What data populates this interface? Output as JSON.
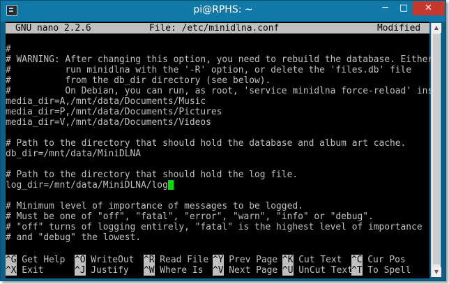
{
  "window": {
    "title": "pi@RPHS: ~",
    "minimize": "─",
    "maximize": "□",
    "close": "✕"
  },
  "nano": {
    "version": "GNU nano 2.2.6",
    "file": "File: /etc/minidlna.conf",
    "status": "Modified"
  },
  "content_lines": [
    "",
    "#",
    "# WARNING: After changing this option, you need to rebuild the database. Either",
    "#          run minidlna with the '-R' option, or delete the 'files.db' file",
    "#          from the db_dir directory (see below).",
    "#          On Debian, you can run, as root, 'service minidlna force-reload' ins$",
    "media_dir=A,/mnt/data/Documents/Music",
    "media_dir=P,/mnt/data/Documents/Pictures",
    "media_dir=V,/mnt/data/Documents/Videos",
    "",
    "# Path to the directory that should hold the database and album art cache.",
    "db_dir=/mnt/data/MiniDLNA",
    "",
    "# Path to the directory that should hold the log file.",
    "log_dir=/mnt/data/MiniDLNA/log",
    "",
    "# Minimum level of importance of messages to be logged.",
    "# Must be one of \"off\", \"fatal\", \"error\", \"warn\", \"info\" or \"debug\".",
    "# \"off\" turns of logging entirely, \"fatal\" is the highest level of importance",
    "# and \"debug\" the lowest."
  ],
  "shortcuts": [
    {
      "key": "^G",
      "label": " Get Help"
    },
    {
      "key": "^O",
      "label": " WriteOut"
    },
    {
      "key": "^R",
      "label": " Read File"
    },
    {
      "key": "^Y",
      "label": " Prev Page"
    },
    {
      "key": "^K",
      "label": " Cut Text"
    },
    {
      "key": "^C",
      "label": " Cur Pos"
    },
    {
      "key": "^X",
      "label": " Exit"
    },
    {
      "key": "^J",
      "label": " Justify"
    },
    {
      "key": "^W",
      "label": " Where Is"
    },
    {
      "key": "^V",
      "label": " Next Page"
    },
    {
      "key": "^U",
      "label": " UnCut Text"
    },
    {
      "key": "^T",
      "label": " To Spell"
    }
  ],
  "scrollbar": {
    "up_arrow": "▲",
    "down_arrow": "▼"
  },
  "colors": {
    "window_frame": "#1079a8",
    "terminal_bg": "#000000",
    "terminal_fg": "#c0c0c0",
    "cursor": "#00e000",
    "close_button": "#c7382c"
  }
}
